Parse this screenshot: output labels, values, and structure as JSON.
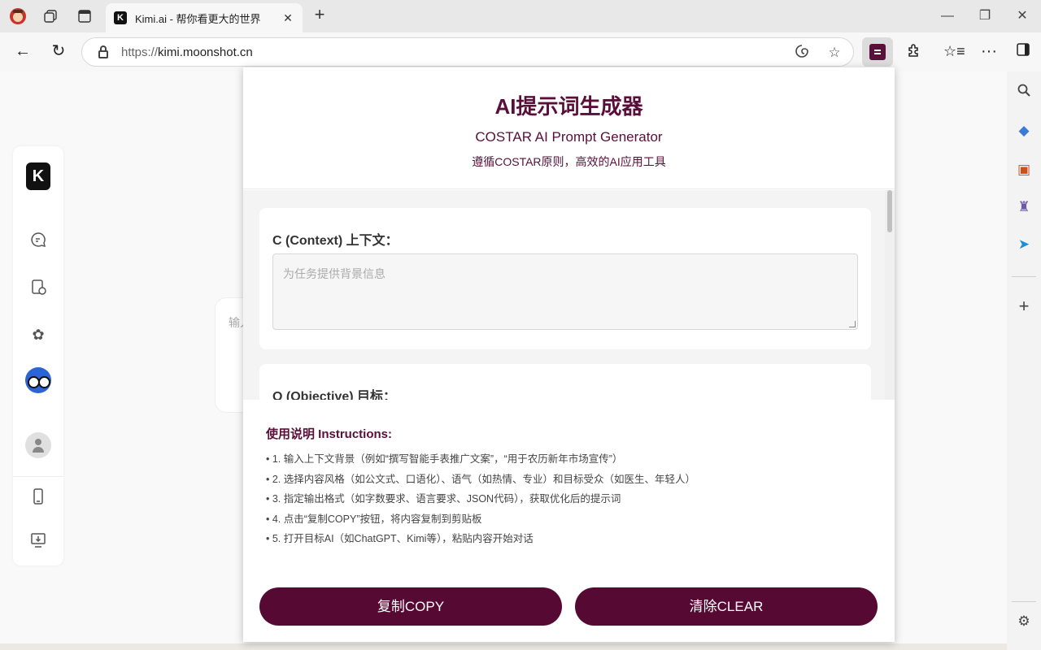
{
  "browser": {
    "tab": {
      "favicon_letter": "K",
      "title": "Kimi.ai - 帮你看更大的世界"
    },
    "url": {
      "scheme": "https://",
      "host": "kimi.moonshot.cn"
    }
  },
  "kimi": {
    "input_placeholder": "输入"
  },
  "popup": {
    "title": "AI提示词生成器",
    "subtitle": "COSTAR AI Prompt Generator",
    "tagline": "遵循COSTAR原则，高效的AI应用工具",
    "fields": [
      {
        "label": "C (Context) 上下文：",
        "placeholder": "为任务提供背景信息"
      },
      {
        "label": "O (Objective) 目标："
      }
    ],
    "instructions": {
      "title": "使用说明 Instructions:",
      "items": [
        "• 1. 输入上下文背景（例如“撰写智能手表推广文案”，“用于农历新年市场宣传”）",
        "• 2. 选择内容风格（如公文式、口语化）、语气（如热情、专业）和目标受众（如医生、年轻人）",
        "• 3. 指定输出格式（如字数要求、语言要求、JSON代码），获取优化后的提示词",
        "• 4. 点击“复制COPY”按钮，将内容复制到剪贴板",
        "• 5. 打开目标AI（如ChatGPT、Kimi等），粘贴内容开始对话"
      ]
    },
    "buttons": {
      "copy": "复制COPY",
      "clear": "清除CLEAR"
    }
  },
  "colors": {
    "accent": "#560933",
    "title": "#5a0f3a"
  }
}
